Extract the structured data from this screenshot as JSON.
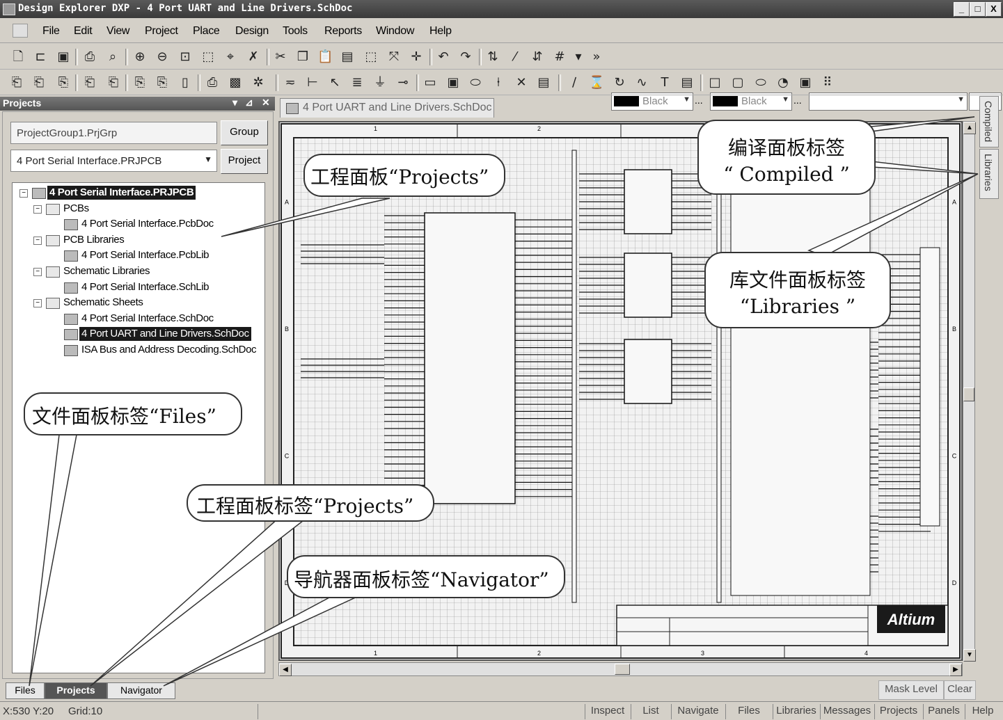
{
  "window": {
    "title": "Design Explorer DXP - 4 Port UART and Line Drivers.SchDoc",
    "controls": {
      "minimize": "_",
      "maximize": "□",
      "close": "X"
    }
  },
  "menu": [
    "File",
    "Edit",
    "View",
    "Project",
    "Place",
    "Design",
    "Tools",
    "Reports",
    "Window",
    "Help"
  ],
  "toolbar": {
    "color1_label": "Black",
    "color2_label": "Black",
    "ellipsis": "..."
  },
  "projects_panel": {
    "title": "Projects",
    "group_field": "ProjectGroup1.PrjGrp",
    "group_button": "Group",
    "project_field": "4 Port Serial Interface.PRJPCB",
    "project_button": "Project",
    "tree": [
      {
        "label": "4 Port Serial Interface.PRJPCB",
        "level": 0,
        "kind": "project",
        "toggle": "−",
        "selected": true
      },
      {
        "label": "PCBs",
        "level": 1,
        "kind": "folder",
        "toggle": "−"
      },
      {
        "label": "4 Port Serial Interface.PcbDoc",
        "level": 2,
        "kind": "pcb-doc"
      },
      {
        "label": "PCB Libraries",
        "level": 1,
        "kind": "folder",
        "toggle": "−"
      },
      {
        "label": "4 Port Serial Interface.PcbLib",
        "level": 2,
        "kind": "pcb-lib"
      },
      {
        "label": "Schematic Libraries",
        "level": 1,
        "kind": "folder",
        "toggle": "−"
      },
      {
        "label": "4 Port Serial Interface.SchLib",
        "level": 2,
        "kind": "sch-lib"
      },
      {
        "label": "Schematic Sheets",
        "level": 1,
        "kind": "folder",
        "toggle": "−"
      },
      {
        "label": "4 Port Serial Interface.SchDoc",
        "level": 2,
        "kind": "sch-doc"
      },
      {
        "label": "4 Port UART and Line Drivers.SchDoc",
        "level": 2,
        "kind": "sch-doc",
        "selected": true
      },
      {
        "label": "ISA Bus and Address Decoding.SchDoc",
        "level": 2,
        "kind": "sch-doc"
      }
    ],
    "tabs": [
      "Files",
      "Projects",
      "Navigator"
    ]
  },
  "document": {
    "tab_label": "4 Port UART and Line Drivers.SchDoc",
    "logo": "Altium",
    "border_numbers": [
      "1",
      "2",
      "3",
      "4"
    ],
    "border_letters": [
      "A",
      "B",
      "C",
      "D"
    ]
  },
  "side_tabs": [
    "Compiled",
    "Libraries"
  ],
  "callouts": {
    "projects_panel": "工程面板“Projects”",
    "compiled_line1": "编译面板标签",
    "compiled_line2": "“ Compiled ”",
    "libraries_line1": "库文件面板标签",
    "libraries_line2": "“Libraries ”",
    "files_tab": "文件面板标签“Files”",
    "projects_tab": "工程面板标签“Projects”",
    "navigator_tab": "导航器面板标签“Navigator”"
  },
  "mask": {
    "label": "Mask Level",
    "clear": "Clear"
  },
  "status": {
    "coords": "X:530 Y:20",
    "grid": "Grid:10",
    "buttons": [
      "Inspect",
      "List",
      "Navigate",
      "Files",
      "Libraries",
      "Messages",
      "Projects",
      "Panels",
      "Help"
    ]
  }
}
